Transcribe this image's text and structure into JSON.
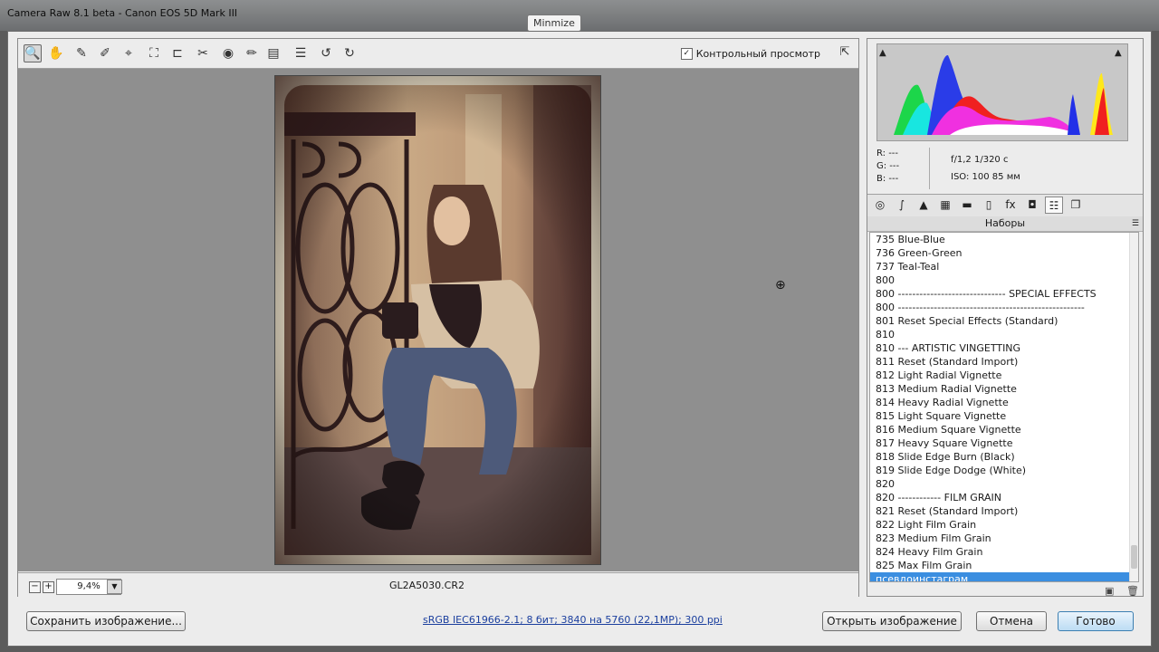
{
  "window": {
    "title": "Camera Raw 8.1 beta  -  Canon EOS 5D Mark III",
    "tooltip": "Minmize"
  },
  "toolbar": {
    "tools": [
      {
        "name": "zoom-tool",
        "icon": "magnifier-icon",
        "glyph": "🔍",
        "active": true
      },
      {
        "name": "hand-tool",
        "icon": "hand-icon",
        "glyph": "✋"
      },
      {
        "name": "white-balance-tool",
        "icon": "eyedropper-icon",
        "glyph": "✎"
      },
      {
        "name": "color-sampler-tool",
        "icon": "color-sampler-icon",
        "glyph": "✐"
      },
      {
        "name": "targeted-adjustment-tool",
        "icon": "target-adjust-icon",
        "glyph": "⌖"
      },
      {
        "name": "crop-tool",
        "icon": "crop-icon",
        "glyph": "⛶"
      },
      {
        "name": "straighten-tool",
        "icon": "straighten-icon",
        "glyph": "⊏"
      },
      {
        "name": "spot-removal-tool",
        "icon": "spot-removal-icon",
        "glyph": "✂"
      },
      {
        "name": "red-eye-tool",
        "icon": "red-eye-icon",
        "glyph": "◉"
      },
      {
        "name": "adjustment-brush-tool",
        "icon": "brush-icon",
        "glyph": "✏"
      },
      {
        "name": "graduated-filter-tool",
        "icon": "graduated-filter-icon",
        "glyph": "▤"
      },
      {
        "name": "preferences-tool",
        "icon": "list-icon",
        "glyph": "☰"
      },
      {
        "name": "rotate-ccw-tool",
        "icon": "rotate-ccw-icon",
        "glyph": "↺"
      },
      {
        "name": "rotate-cw-tool",
        "icon": "rotate-cw-icon",
        "glyph": "↻"
      }
    ],
    "preview_label": "Контрольный просмотр",
    "preview_checked": "✓"
  },
  "status": {
    "zoom": "9,4%",
    "filename": "GL2A5030.CR2"
  },
  "info": {
    "r": "R:   ---",
    "g": "G:   ---",
    "b": "B:   ---",
    "aperture_shutter": "f/1,2    1/320 с",
    "iso_focal": "ISO: 100    85 мм"
  },
  "panel_tabs": [
    {
      "name": "tab-basic",
      "icon": "aperture-icon",
      "glyph": "◎"
    },
    {
      "name": "tab-tone-curve",
      "icon": "curve-icon",
      "glyph": "∫"
    },
    {
      "name": "tab-detail",
      "icon": "triangle-icon",
      "glyph": "▲"
    },
    {
      "name": "tab-hsl",
      "icon": "hsl-icon",
      "glyph": "▦"
    },
    {
      "name": "tab-split-toning",
      "icon": "split-toning-icon",
      "glyph": "▬"
    },
    {
      "name": "tab-lens-corrections",
      "icon": "lens-icon",
      "glyph": "▯"
    },
    {
      "name": "tab-effects",
      "icon": "fx-icon",
      "glyph": "fx"
    },
    {
      "name": "tab-camera-calibration",
      "icon": "camera-icon",
      "glyph": "◘"
    },
    {
      "name": "tab-presets",
      "icon": "sliders-icon",
      "glyph": "☷",
      "active": true
    },
    {
      "name": "tab-snapshots",
      "icon": "snapshots-icon",
      "glyph": "❐"
    }
  ],
  "presets": {
    "header": "Наборы",
    "menu_glyph": "☰",
    "items": [
      "735 Blue-Blue",
      "736 Green-Green",
      "737 Teal-Teal",
      "800",
      "800 ------------------------------ SPECIAL EFFECTS",
      "800 ----------------------------------------------------",
      "801 Reset Special Effects (Standard)",
      "810",
      "810 --- ARTISTIC VINGETTING",
      "811 Reset (Standard Import)",
      "812 Light Radial Vignette",
      "813 Medium Radial Vignette",
      "814 Heavy Radial Vignette",
      "815 Light Square Vignette",
      "816 Medium Square Vignette",
      "817 Heavy Square Vignette",
      "818 Slide Edge Burn (Black)",
      "819 Slide Edge Dodge (White)",
      "820",
      "820 ------------ FILM GRAIN",
      "821 Reset (Standard Import)",
      "822 Light Film Grain",
      "823 Medium Film Grain",
      "824 Heavy Film Grain",
      "825 Max Film Grain",
      "псевдоинстаграм"
    ],
    "selected": "псевдоинстаграм"
  },
  "footer": {
    "save_button": "Сохранить изображение...",
    "workflow_link": "sRGB IEC61966-2.1; 8 бит; 3840 на 5760 (22,1MP); 300 ppi",
    "open_button": "Открыть изображение",
    "cancel_button": "Отмена",
    "done_button": "Готово"
  },
  "colors": {
    "selection": "#3b8ee0",
    "link": "#1b3f9e",
    "canvas": "#8f8f8f"
  }
}
